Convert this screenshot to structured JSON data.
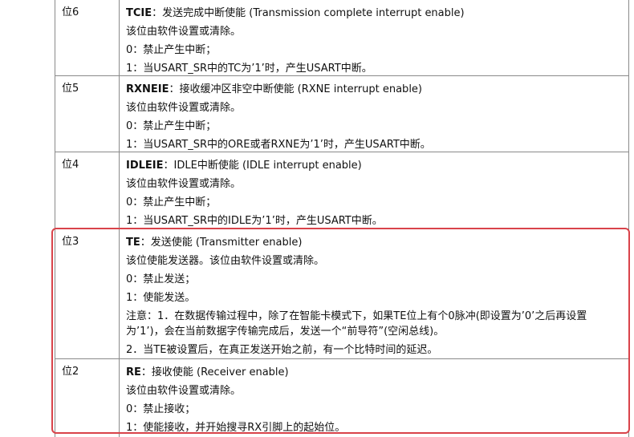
{
  "rows": [
    {
      "bit": "位6",
      "name": "TCIE",
      "title_rest": "：发送完成中断使能 (Transmission complete interrupt enable)",
      "lines": [
        "该位由软件设置或清除。",
        "0：禁止产生中断；",
        "1：当USART_SR中的TC为’1’时，产生USART中断。"
      ]
    },
    {
      "bit": "位5",
      "name": "RXNEIE",
      "title_rest": "：接收缓冲区非空中断使能 (RXNE interrupt enable)",
      "lines": [
        "该位由软件设置或清除。",
        "0：禁止产生中断；",
        "1：当USART_SR中的ORE或者RXNE为’1’时，产生USART中断。"
      ]
    },
    {
      "bit": "位4",
      "name": "IDLEIE",
      "title_rest": "：IDLE中断使能 (IDLE interrupt enable)",
      "lines": [
        "该位由软件设置或清除。",
        "0：禁止产生中断；",
        "1：当USART_SR中的IDLE为’1’时，产生USART中断。"
      ]
    },
    {
      "bit": "位3",
      "name": "TE",
      "title_rest": "：发送使能 (Transmitter enable)",
      "lines": [
        "该位使能发送器。该位由软件设置或清除。",
        "0：禁止发送；",
        "1：使能发送。",
        "注意：1．在数据传输过程中，除了在智能卡模式下，如果TE位上有个0脉冲(即设置为’0’之后再设置为’1’)，会在当前数据字传输完成后，发送一个“前导符”(空闲总线)。",
        "2．当TE被设置后，在真正发送开始之前，有一个比特时间的延迟。"
      ]
    },
    {
      "bit": "位2",
      "name": "RE",
      "title_rest": "：接收使能 (Receiver enable)",
      "lines": [
        "该位由软件设置或清除。",
        "0：禁止接收；",
        "1：使能接收，并开始搜寻RX引脚上的起始位。"
      ]
    }
  ],
  "colors": {
    "highlight": "#d9434a",
    "border": "#8a8a8a",
    "text": "#111111"
  }
}
